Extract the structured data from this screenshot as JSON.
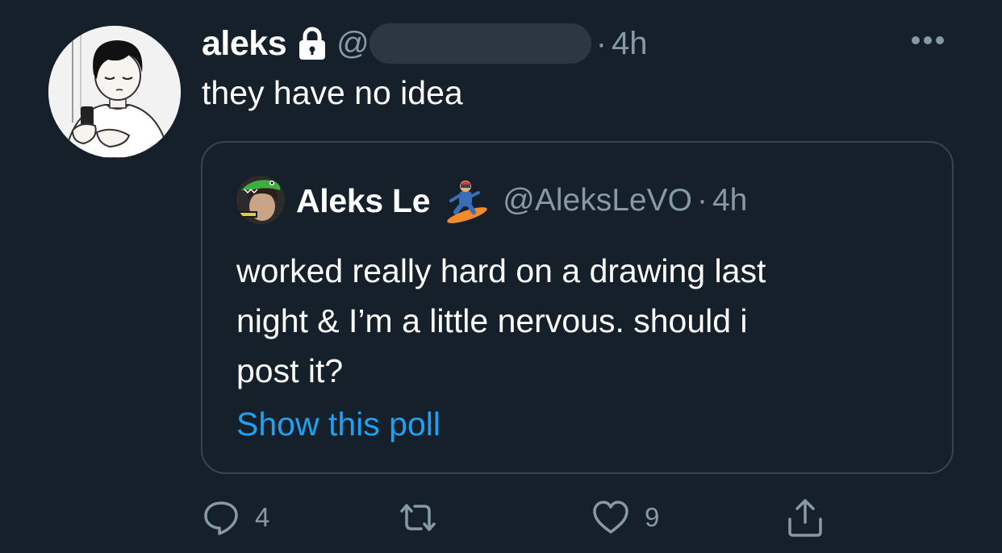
{
  "tweet": {
    "display_name": "aleks",
    "handle_prefix": "@",
    "separator": "·",
    "time": "4h",
    "text": "they have no idea"
  },
  "quoted_tweet": {
    "display_name": "Aleks Le",
    "handle": "@AleksLeVO",
    "separator": "·",
    "time": "4h",
    "text_lines": [
      "worked really hard on a drawing last",
      "night & I’m a little nervous. should i",
      "post it?"
    ],
    "show_poll_label": "Show this poll"
  },
  "actions": {
    "reply_count": "4",
    "retweet_count": "",
    "like_count": "9"
  },
  "icons": {
    "lock": "lock-icon",
    "more": "more-icon",
    "snowboarder": "snowboarder-emoji-icon",
    "reply": "reply-icon",
    "retweet": "retweet-icon",
    "like": "heart-icon",
    "share": "share-icon"
  },
  "colors": {
    "background": "#15202b",
    "text_primary": "#ffffff",
    "text_secondary": "#8899a6",
    "link": "#1da1f2",
    "border": "#38444d"
  }
}
